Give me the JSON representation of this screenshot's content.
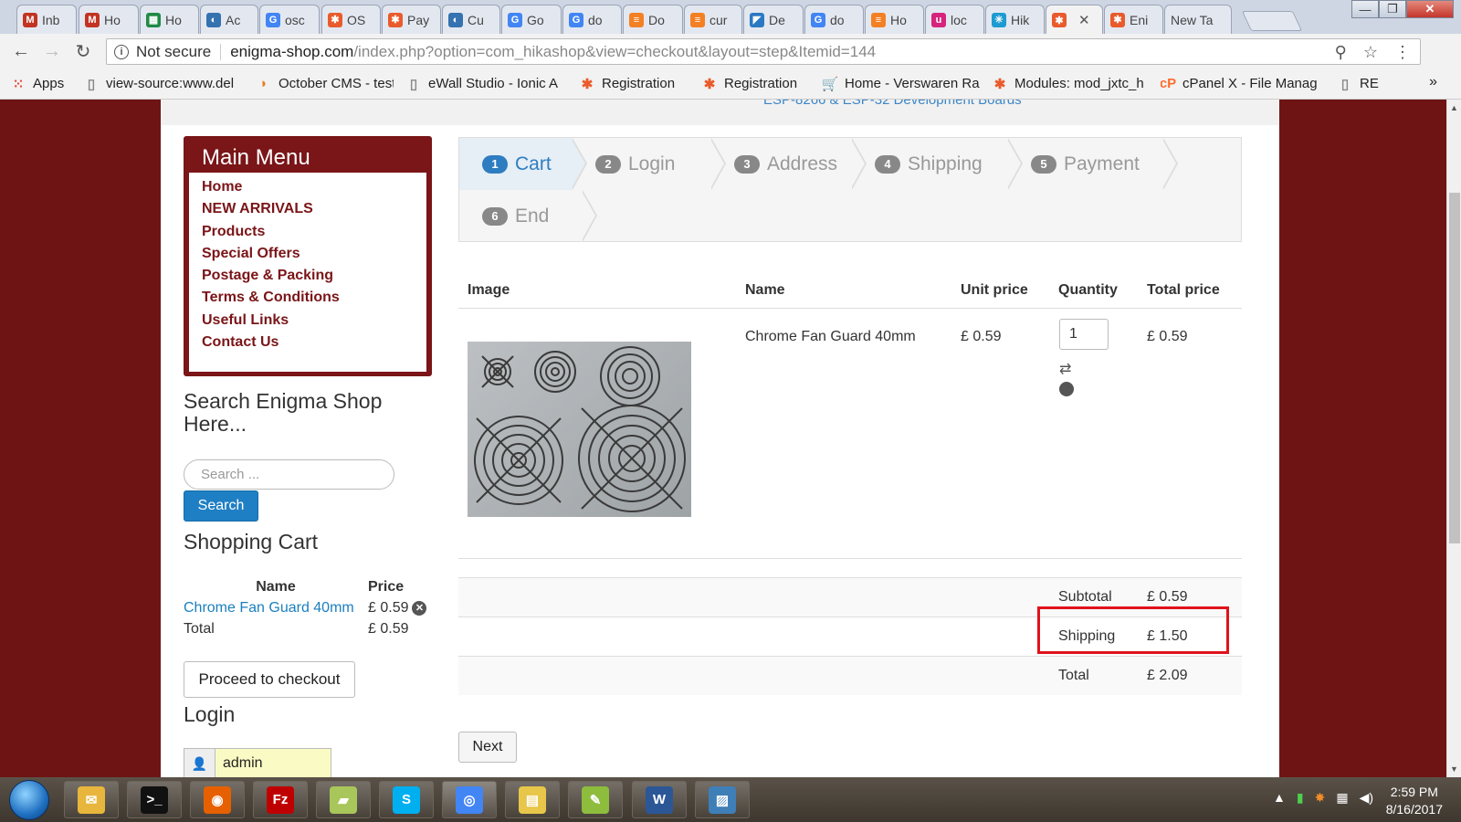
{
  "browser": {
    "tabs": [
      {
        "label": "Inb",
        "icon": "gmail-icon",
        "color": "#c23321",
        "glyph": "M"
      },
      {
        "label": "Ho",
        "icon": "gmail-icon",
        "color": "#c23321",
        "glyph": "M"
      },
      {
        "label": "Ho",
        "icon": "sheets-icon",
        "color": "#1f8a46",
        "glyph": "▦"
      },
      {
        "label": "Ac",
        "icon": "circle-icon",
        "color": "#3572b0",
        "glyph": "◐"
      },
      {
        "label": "osc",
        "icon": "google-icon",
        "color": "#4285f4",
        "glyph": "G"
      },
      {
        "label": "OS",
        "icon": "joomla-icon",
        "color": "#e95b2c",
        "glyph": "✱"
      },
      {
        "label": "Pay",
        "icon": "joomla-icon",
        "color": "#e95b2c",
        "glyph": "✱"
      },
      {
        "label": "Cu",
        "icon": "circle-icon",
        "color": "#3572b0",
        "glyph": "◐"
      },
      {
        "label": "Go",
        "icon": "google-icon",
        "color": "#4285f4",
        "glyph": "G"
      },
      {
        "label": "do",
        "icon": "google-icon",
        "color": "#4285f4",
        "glyph": "G"
      },
      {
        "label": "Do",
        "icon": "stack-icon",
        "color": "#f48024",
        "glyph": "≡"
      },
      {
        "label": "cur",
        "icon": "stack-icon",
        "color": "#f48024",
        "glyph": "≡"
      },
      {
        "label": "De",
        "icon": "vscode-icon",
        "color": "#2b79c2",
        "glyph": "◤"
      },
      {
        "label": "do",
        "icon": "google-icon",
        "color": "#4285f4",
        "glyph": "G"
      },
      {
        "label": "Ho",
        "icon": "stack-icon",
        "color": "#f48024",
        "glyph": "≡"
      },
      {
        "label": "loc",
        "icon": "circle-u-icon",
        "color": "#d6247e",
        "glyph": "u"
      },
      {
        "label": "Hik",
        "icon": "asterisk-icon",
        "color": "#1d9bd1",
        "glyph": "✳"
      },
      {
        "label": "",
        "icon": "joomla-icon",
        "color": "#e95b2c",
        "glyph": "✱",
        "active": true,
        "close": "✕"
      },
      {
        "label": "Eni",
        "icon": "joomla-icon",
        "color": "#e95b2c",
        "glyph": "✱"
      },
      {
        "label": "New Ta",
        "icon": "",
        "color": "",
        "glyph": ""
      }
    ],
    "window_buttons": {
      "minimize": "—",
      "maximize": "❐",
      "close": "✕"
    },
    "nav": {
      "back": "←",
      "forward": "→",
      "reload": "↻"
    },
    "address": {
      "security": "Not secure",
      "domain": "enigma-shop.com",
      "path": "/index.php?option=com_hikashop&view=checkout&layout=step&Itemid=144",
      "icons": {
        "paint": "⚲",
        "star": "☆",
        "menu": "⋮"
      }
    },
    "bookmarks": [
      {
        "label": "Apps",
        "icon": "apps-grid-icon",
        "color": "#e94235",
        "glyph": "⁙"
      },
      {
        "label": "view-source:www.del",
        "icon": "page-icon",
        "color": "#888888",
        "glyph": "▯"
      },
      {
        "label": "October CMS - test",
        "icon": "october-icon",
        "color": "#e67e22",
        "glyph": "◗"
      },
      {
        "label": "eWall Studio - Ionic A",
        "icon": "page-icon",
        "color": "#888888",
        "glyph": "▯"
      },
      {
        "label": "Registration",
        "icon": "joomla-icon",
        "color": "#e95b2c",
        "glyph": "✱"
      },
      {
        "label": "Registration",
        "icon": "joomla-icon",
        "color": "#e95b2c",
        "glyph": "✱"
      },
      {
        "label": "Home - Verswaren Ra",
        "icon": "cart-icon",
        "color": "#555555",
        "glyph": "🛒"
      },
      {
        "label": "Modules: mod_jxtc_h",
        "icon": "joomla-icon",
        "color": "#e95b2c",
        "glyph": "✱"
      },
      {
        "label": "cPanel X - File Manag",
        "icon": "cpanel-icon",
        "color": "#ff6c2c",
        "glyph": "cP"
      },
      {
        "label": "RE",
        "icon": "page-icon",
        "color": "#888888",
        "glyph": "▯"
      }
    ],
    "bookmarks_more": "»"
  },
  "page": {
    "top_link": "ESP-8266 & ESP-32 Development Boards",
    "main_menu": {
      "title": "Main Menu",
      "items": [
        "Home",
        "NEW ARRIVALS",
        "Products",
        "Special Offers",
        "Postage & Packing",
        "Terms & Conditions",
        "Useful Links",
        "Contact Us"
      ]
    },
    "search": {
      "title": "Search Enigma Shop Here...",
      "placeholder": "Search ...",
      "button": "Search"
    },
    "shopping_cart": {
      "title": "Shopping Cart",
      "headers": [
        "Name",
        "Price"
      ],
      "items": [
        {
          "name": "Chrome Fan Guard 40mm",
          "price": "£ 0.59"
        }
      ],
      "total_label": "Total",
      "total_value": "£ 0.59",
      "checkout_button": "Proceed to checkout"
    },
    "login": {
      "title": "Login",
      "username": "admin"
    },
    "steps": [
      {
        "num": "1",
        "label": "Cart",
        "active": true
      },
      {
        "num": "2",
        "label": "Login"
      },
      {
        "num": "3",
        "label": "Address"
      },
      {
        "num": "4",
        "label": "Shipping"
      },
      {
        "num": "5",
        "label": "Payment"
      },
      {
        "num": "6",
        "label": "End"
      }
    ],
    "cart_table": {
      "headers": {
        "image": "Image",
        "name": "Name",
        "unit_price": "Unit price",
        "quantity": "Quantity",
        "total_price": "Total price"
      },
      "item": {
        "name": "Chrome Fan Guard 40mm",
        "unit_price": "£ 0.59",
        "quantity": "1",
        "total_price": "£ 0.59"
      },
      "subtotal_label": "Subtotal",
      "subtotal_value": "£ 0.59",
      "shipping_label": "Shipping",
      "shipping_value": "£ 1.50",
      "total_label": "Total",
      "total_value": "£ 2.09"
    },
    "next_button": "Next"
  },
  "taskbar": {
    "apps": [
      {
        "icon": "outlook-icon",
        "color": "#e8b63c",
        "glyph": "✉"
      },
      {
        "icon": "cmd-icon",
        "color": "#111111",
        "glyph": ">_"
      },
      {
        "icon": "firefox-icon",
        "color": "#e66000",
        "glyph": "◉"
      },
      {
        "icon": "filezilla-icon",
        "color": "#bf0000",
        "glyph": "Fz"
      },
      {
        "icon": "notes-icon",
        "color": "#a9c65a",
        "glyph": "▰"
      },
      {
        "icon": "skype-icon",
        "color": "#00aff0",
        "glyph": "S"
      },
      {
        "icon": "chrome-icon",
        "color": "#4285f4",
        "glyph": "◎"
      },
      {
        "icon": "explorer-icon",
        "color": "#e7c64a",
        "glyph": "▤"
      },
      {
        "icon": "notepadpp-icon",
        "color": "#8ebc3d",
        "glyph": "✎"
      },
      {
        "icon": "word-icon",
        "color": "#2b5797",
        "glyph": "W"
      },
      {
        "icon": "photos-icon",
        "color": "#3f7fb8",
        "glyph": "▨"
      }
    ],
    "tray_icons": {
      "arrow": "▲",
      "battery": "▮",
      "avast": "✸",
      "network": "▦",
      "volume": "◀)"
    },
    "time": "2:59 PM",
    "date": "8/16/2017"
  }
}
